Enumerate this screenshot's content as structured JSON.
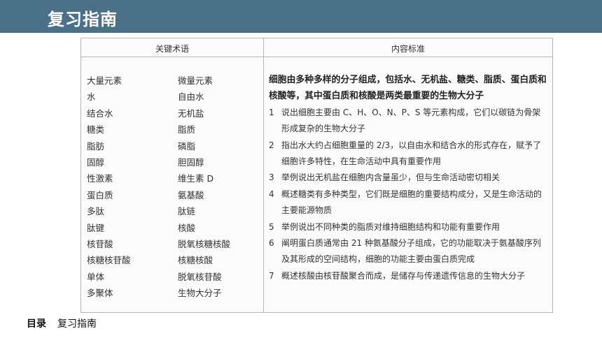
{
  "header": {
    "title": "复习指南"
  },
  "table": {
    "col_left": "关键术语",
    "col_right": "内容标准",
    "terms": [
      [
        "大量元素",
        "微量元素"
      ],
      [
        "水",
        "自由水"
      ],
      [
        "结合水",
        "无机盐"
      ],
      [
        "糖类",
        "脂质"
      ],
      [
        "脂肪",
        "磷脂"
      ],
      [
        "固醇",
        "胆固醇"
      ],
      [
        "性激素",
        "维生素 D"
      ],
      [
        "蛋白质",
        "氨基酸"
      ],
      [
        "多肽",
        "肽链"
      ],
      [
        "肽键",
        "核酸"
      ],
      [
        "核苷酸",
        "脱氧核糖核酸"
      ],
      [
        "核糖核苷酸",
        "核糖核酸"
      ],
      [
        "单体",
        "脱氧核苷酸"
      ],
      [
        "多聚体",
        "生物大分子"
      ]
    ],
    "intro": "细胞由多种多样的分子组成，包括水、无机盐、糖类、脂质、蛋白质和核酸等，其中蛋白质和核酸是两类最重要的生物大分子",
    "items": [
      {
        "num": "1",
        "text": "说出细胞主要由 C、H、O、N、P、S 等元素构成，它们以碳链为骨架形成复杂的生物大分子"
      },
      {
        "num": "2",
        "text": "指出水大约占细胞重量的 2/3，以自由水和结合水的形式存在，赋予了细胞许多特性，在生命活动中具有重要作用"
      },
      {
        "num": "3",
        "text": "举例说出无机盐在细胞内含量虽少，但与生命活动密切相关"
      },
      {
        "num": "4",
        "text": "概述糖类有多种类型，它们既是细胞的重要结构成分，又是生命活动的主要能源物质"
      },
      {
        "num": "5",
        "text": "举例说出不同种类的脂质对维持细胞结构和功能有重要作用"
      },
      {
        "num": "6",
        "text": "阐明蛋白质通常由 21 种氨基酸分子组成，它的功能取决于氨基酸序列及其形成的空间结构，细胞的功能主要由蛋白质完成"
      },
      {
        "num": "7",
        "text": "概述核酸由核苷酸聚合而成，是储存与传递遗传信息的生物大分子"
      }
    ]
  },
  "footer": {
    "label": "目录",
    "text": "复习指南"
  }
}
